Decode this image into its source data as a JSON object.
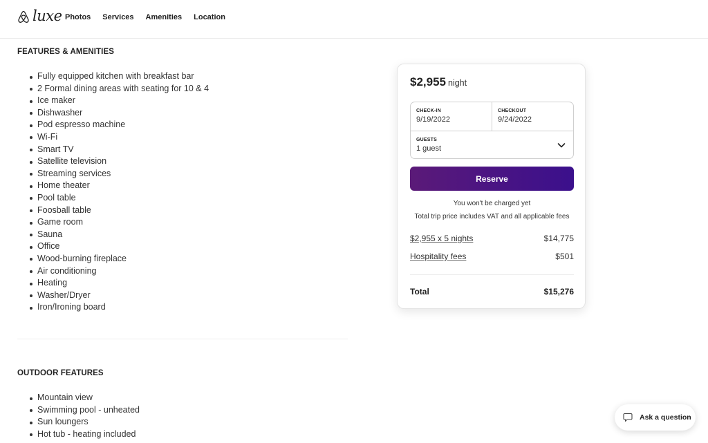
{
  "nav": {
    "logo_text": "luxe",
    "links": [
      {
        "label": "Photos"
      },
      {
        "label": "Services"
      },
      {
        "label": "Amenities"
      },
      {
        "label": "Location"
      }
    ]
  },
  "features": {
    "title": "FEATURES & AMENITIES",
    "items": [
      "Fully equipped kitchen with breakfast bar",
      "2 Formal dining areas with seating for 10 & 4",
      "Ice maker",
      "Dishwasher",
      "Pod espresso machine",
      "Wi-Fi",
      "Smart TV",
      "Satellite television",
      "Streaming services",
      "Home theater",
      "Pool table",
      "Foosball table",
      "Game room",
      "Sauna",
      "Office",
      "Wood-burning fireplace",
      "Air conditioning",
      "Heating",
      "Washer/Dryer",
      "Iron/Ironing board"
    ]
  },
  "outdoor": {
    "title": "OUTDOOR FEATURES",
    "items": [
      "Mountain view",
      "Swimming pool - unheated",
      "Sun loungers",
      "Hot tub - heating included"
    ]
  },
  "booking": {
    "price": "$2,955",
    "price_unit": "night",
    "checkin_label": "CHECK-IN",
    "checkin_value": "9/19/2022",
    "checkout_label": "CHECKOUT",
    "checkout_value": "9/24/2022",
    "guests_label": "GUESTS",
    "guests_value": "1 guest",
    "reserve_label": "Reserve",
    "note_charged": "You won't be charged yet",
    "note_vat": "Total trip price includes VAT and all applicable fees",
    "line_items": [
      {
        "label": "$2,955 x 5 nights",
        "amount": "$14,775"
      },
      {
        "label": "Hospitality fees",
        "amount": "$501"
      }
    ],
    "total_label": "Total",
    "total_amount": "$15,276",
    "accent_color": "#4a1483"
  },
  "ask": {
    "label": "Ask a question"
  }
}
